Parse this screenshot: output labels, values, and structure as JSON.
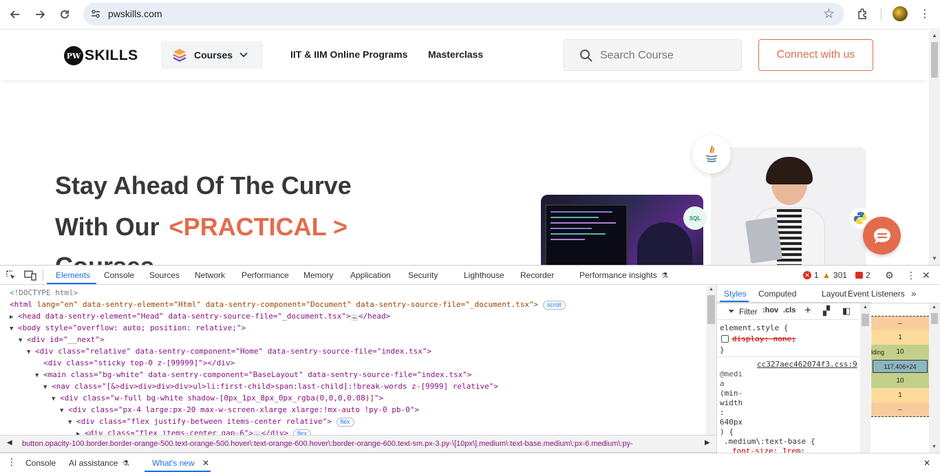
{
  "browser": {
    "url": "pwskills.com"
  },
  "site": {
    "logo_text": "SKILLS",
    "logo_badge": "PW",
    "courses_label": "Courses",
    "nav_links": [
      "IIT & IIM Online Programs",
      "Masterclass"
    ],
    "search_placeholder": "Search Course",
    "connect_label": "Connect with us",
    "hero_line1": "Stay Ahead Of The Curve",
    "hero_line2": "With Our",
    "hero_accent": "<PRACTICAL >",
    "hero_line3": "Courses",
    "accent_color": "#e36c4c",
    "sql_badge": "SQL"
  },
  "devtools": {
    "tabs": [
      "Elements",
      "Console",
      "Sources",
      "Network",
      "Performance",
      "Memory",
      "Application",
      "Security",
      "Lighthouse",
      "Recorder",
      "Performance insights"
    ],
    "active_tab": "Elements",
    "errors": "1",
    "warnings": "301",
    "issues": "2",
    "dom_lines": {
      "l0": "<!DOCTYPE html>",
      "l1_tag": "<html",
      "l1_attrs": " lang=\"en\" data-sentry-element=\"Html\" data-sentry-component=\"Document\" data-sentry-source-file=\"_document.tsx\">",
      "l1_chip": "scroll",
      "l2": "<head data-sentry-element=\"Head\" data-sentry-source-file=\"_document.tsx\">",
      "l2_end": "</head>",
      "l3": "<body style=\"overflow: auto; position: relative;\">",
      "l4": "<div id=\"__next\">",
      "l5": "<div class=\"relative\" data-sentry-component=\"Home\" data-sentry-source-file=\"index.tsx\">",
      "l6": "<div class=\"sticky top-0 z-[99999]\"></div>",
      "l7": "<main class=\"bg-white\" data-sentry-component=\"BaseLayout\" data-sentry-source-file=\"index.tsx\">",
      "l8": "<nav class=\"[&>div>div>div>div>ul>li:first-child>span:last-child]:!break-words z-[9999] relative\">",
      "l9": "<div class=\"w-full bg-white shadow-[0px_1px_8px_0px_rgba(0,0,0,0.08)]\">",
      "l10": "<div class=\"px-4 large:px-20 max-w-screen-xlarge xlarge:!mx-auto !py-0 pb-0\">",
      "l11": "<div class=\"flex justify-between items-center relative\">",
      "l11_chip": "flex",
      "l12": "<div class=\"flex items-center gap-6\">",
      "l12_end": "</div>",
      "l12_chip": "flex"
    },
    "breadcrumb": "button.opacity-100.border.border-orange-500.text-orange-500.hover\\:text-orange-600.hover\\:border-orange-600.text-sm.px-3.py-\\[10px\\].medium\\:text-base.medium\\:px-6.medium\\:py-",
    "styles_tabs": [
      "Styles",
      "Computed",
      "Layout",
      "Event Listeners"
    ],
    "filter_label": "Filter",
    "hov_label": ":hov",
    "cls_label": ".cls",
    "element_style": "element.style {",
    "strike_decl": "display: none;",
    "close_brace": "}",
    "css_source": "cc327aec462074f3.css:9",
    "media_lines": [
      "@medi",
      "a",
      "(min-",
      "width",
      ":",
      "640px",
      ") {"
    ],
    "rule_selector": ".medium\\:text-base {",
    "rule_decl": "font-size: 1rem;",
    "boxmodel": [
      "–",
      "1",
      "10",
      "117.406×24",
      "10",
      "1",
      "–"
    ],
    "boxmodel_padding_label": "lding",
    "drawer_tabs": [
      "Console",
      "AI assistance",
      "What's new"
    ],
    "drawer_active": "What's new"
  }
}
